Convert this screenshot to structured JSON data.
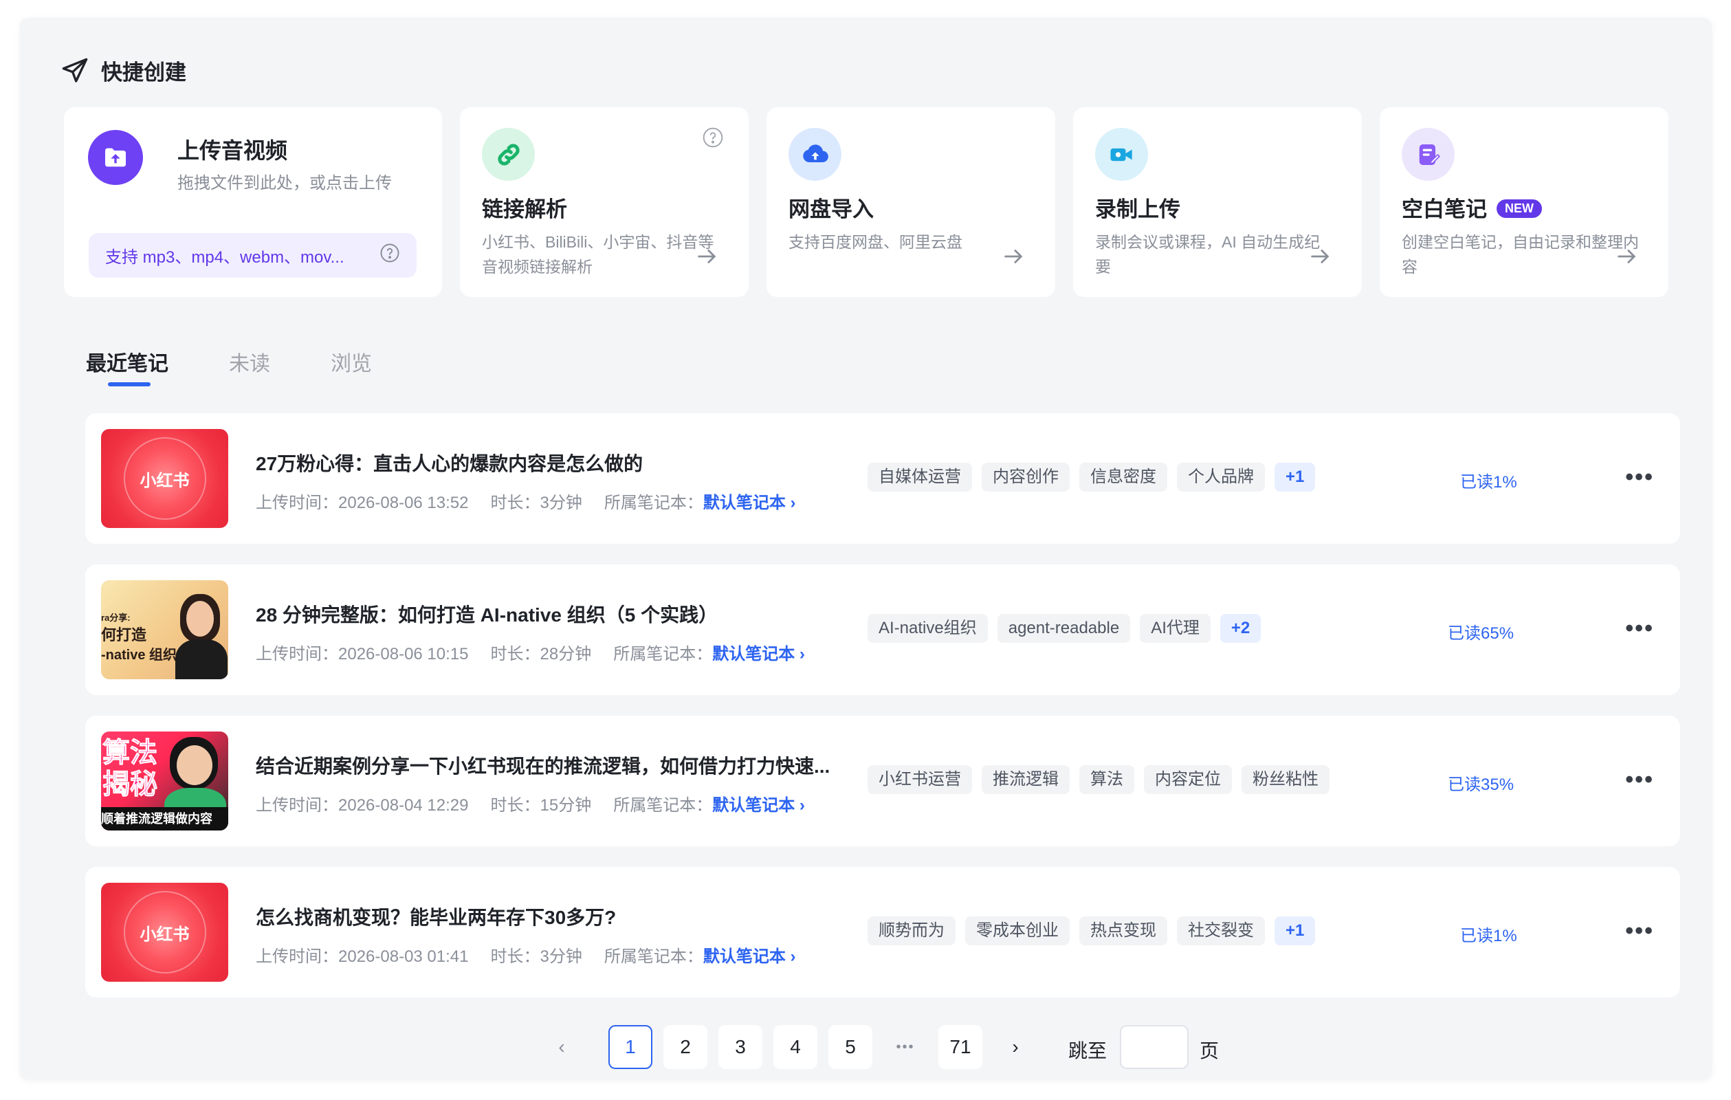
{
  "quick_create": {
    "title": "快捷创建",
    "upload": {
      "title": "上传音视频",
      "desc": "拖拽文件到此处，或点击上传",
      "support": "支持 mp3、mp4、webm、mov..."
    },
    "cards": [
      {
        "title": "链接解析",
        "desc": "小红书、BiliBili、小宇宙、抖音等音视频链接解析",
        "icon": "link-icon"
      },
      {
        "title": "网盘导入",
        "desc": "支持百度网盘、阿里云盘",
        "icon": "cloud-upload-icon"
      },
      {
        "title": "录制上传",
        "desc": "录制会议或课程，AI 自动生成纪要",
        "icon": "video-camera-icon"
      },
      {
        "title": "空白笔记",
        "desc": "创建空白笔记，自由记录和整理内容",
        "icon": "edit-note-icon",
        "badge": "NEW"
      }
    ]
  },
  "tabs": [
    "最近笔记",
    "未读",
    "浏览"
  ],
  "active_tab": 0,
  "notes": [
    {
      "title": "27万粉心得：直击人心的爆款内容是怎么做的",
      "upload_time": "上传时间：2026-08-06 13:52",
      "duration": "时长：3分钟",
      "notebook_label": "所属笔记本：",
      "notebook": "默认笔记本 ›",
      "tags": [
        "自媒体运营",
        "内容创作",
        "信息密度",
        "个人品牌"
      ],
      "more": "+1",
      "read": "已读1%",
      "thumb_text": "小红书"
    },
    {
      "title": "28 分钟完整版：如何打造 AI-native 组织（5 个实践）",
      "upload_time": "上传时间：2026-08-06 10:15",
      "duration": "时长：28分钟",
      "notebook_label": "所属笔记本：",
      "notebook": "默认笔记本 ›",
      "tags": [
        "AI-native组织",
        "agent-readable",
        "AI代理"
      ],
      "more": "+2",
      "read": "已读65%",
      "thumb_lines": [
        "ra分享:",
        "何打造",
        "-native 组织"
      ]
    },
    {
      "title": "结合近期案例分享一下小红书现在的推流逻辑，如何借力打力快速...",
      "upload_time": "上传时间：2026-08-04 12:29",
      "duration": "时长：15分钟",
      "notebook_label": "所属笔记本：",
      "notebook": "默认笔记本 ›",
      "tags": [
        "小红书运营",
        "推流逻辑",
        "算法",
        "内容定位",
        "粉丝粘性"
      ],
      "more": "",
      "read": "已读35%",
      "thumb_lines": [
        "算法",
        "揭秘",
        "顺着推流逻辑做内容"
      ]
    },
    {
      "title": "怎么找商机变现？能毕业两年存下30多万?",
      "upload_time": "上传时间：2026-08-03 01:41",
      "duration": "时长：3分钟",
      "notebook_label": "所属笔记本：",
      "notebook": "默认笔记本 ›",
      "tags": [
        "顺势而为",
        "零成本创业",
        "热点变现",
        "社交裂变"
      ],
      "more": "+1",
      "read": "已读1%",
      "thumb_text": "小红书"
    }
  ],
  "pagination": {
    "pages": [
      "1",
      "2",
      "3",
      "4",
      "5"
    ],
    "ellipsis": "•••",
    "last": "71",
    "current": "1",
    "jump_label": "跳至",
    "page_label": "页"
  },
  "colors": {
    "accent": "#2d64f0",
    "purple": "#6238e8",
    "background": "#f4f5f7"
  }
}
